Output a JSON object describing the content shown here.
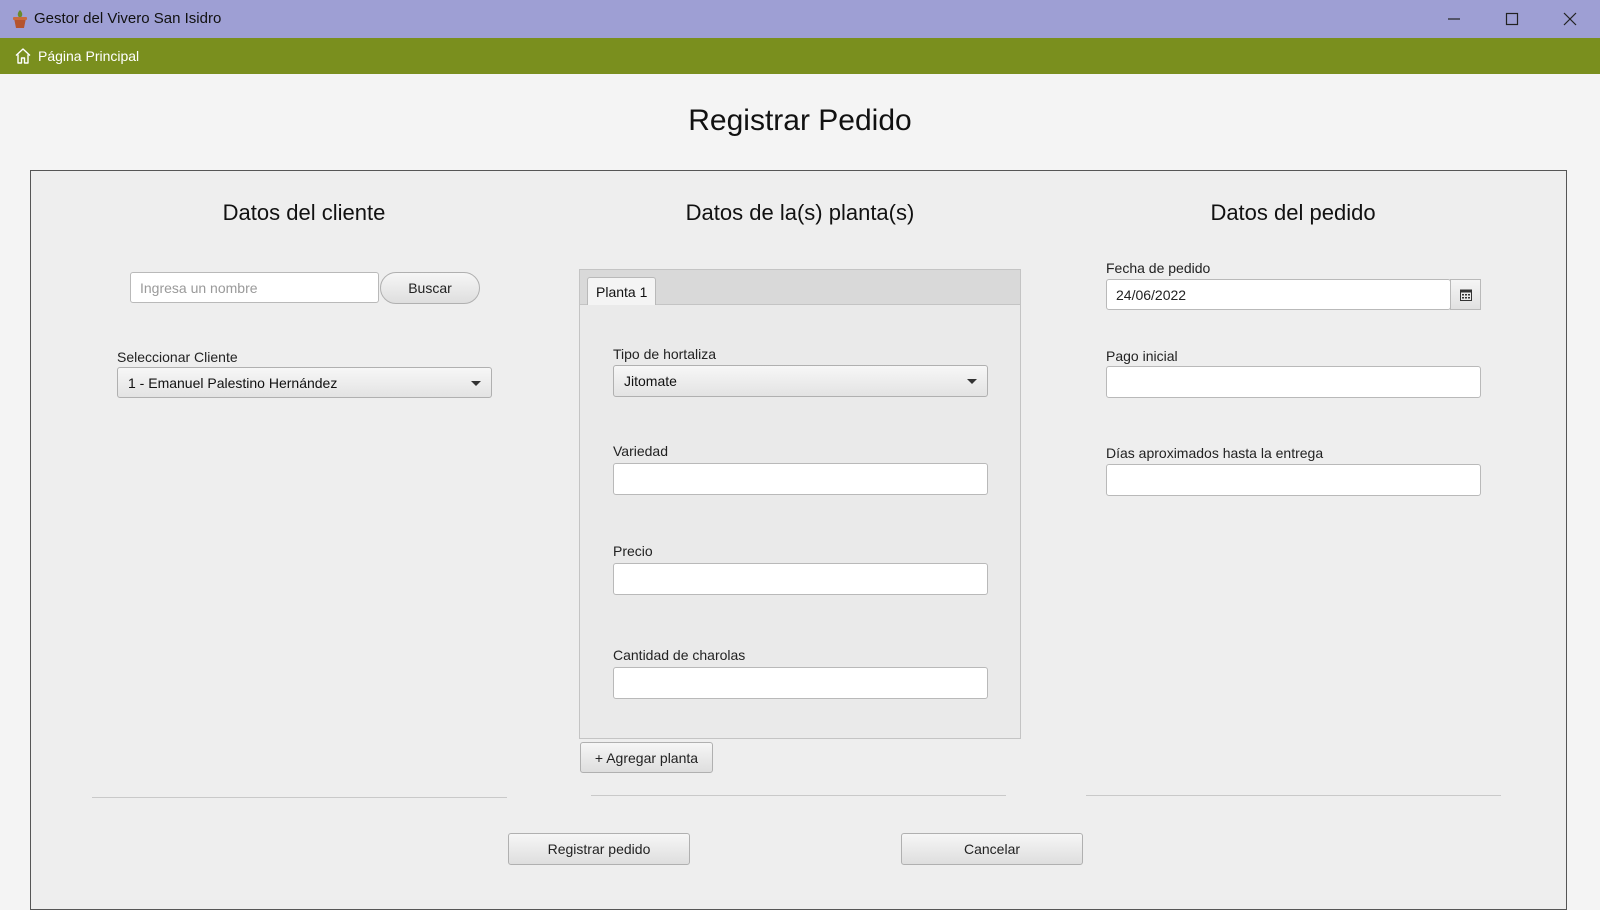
{
  "window": {
    "title": "Gestor del Vivero San Isidro",
    "icons": [
      "plant-pot-icon",
      "minimize-icon",
      "maximize-icon",
      "close-icon"
    ]
  },
  "menubar": {
    "home_label": "Página Principal",
    "home_icon": "home-icon",
    "color": "#7a8f1e"
  },
  "page": {
    "title": "Registrar Pedido"
  },
  "cliente": {
    "title": "Datos del cliente",
    "search_placeholder": "Ingresa un nombre",
    "search_value": "",
    "search_button": "Buscar",
    "select_label": "Seleccionar Cliente",
    "selected": "1 - Emanuel Palestino Hernández"
  },
  "plantas": {
    "title": "Datos de la(s) planta(s)",
    "tabs": [
      {
        "label": "Planta 1",
        "selected": true
      }
    ],
    "tipo_label": "Tipo de hortaliza",
    "tipo_selected": "Jitomate",
    "variedad_label": "Variedad",
    "variedad_value": "",
    "precio_label": "Precio",
    "precio_value": "",
    "cantidad_label": "Cantidad de charolas",
    "cantidad_value": "",
    "add_button": "+ Agregar planta"
  },
  "pedido": {
    "title": "Datos del pedido",
    "fecha_label": "Fecha de pedido",
    "fecha_value": "24/06/2022",
    "calendar_icon": "calendar-icon",
    "pago_label": "Pago inicial",
    "pago_value": "",
    "dias_label": "Días aproximados hasta la entrega",
    "dias_value": ""
  },
  "actions": {
    "register": "Registrar pedido",
    "cancel": "Cancelar"
  },
  "colors": {
    "titlebar": "#9e9fd4",
    "menubar": "#7a8f1e",
    "panel": "#eeeeee"
  }
}
